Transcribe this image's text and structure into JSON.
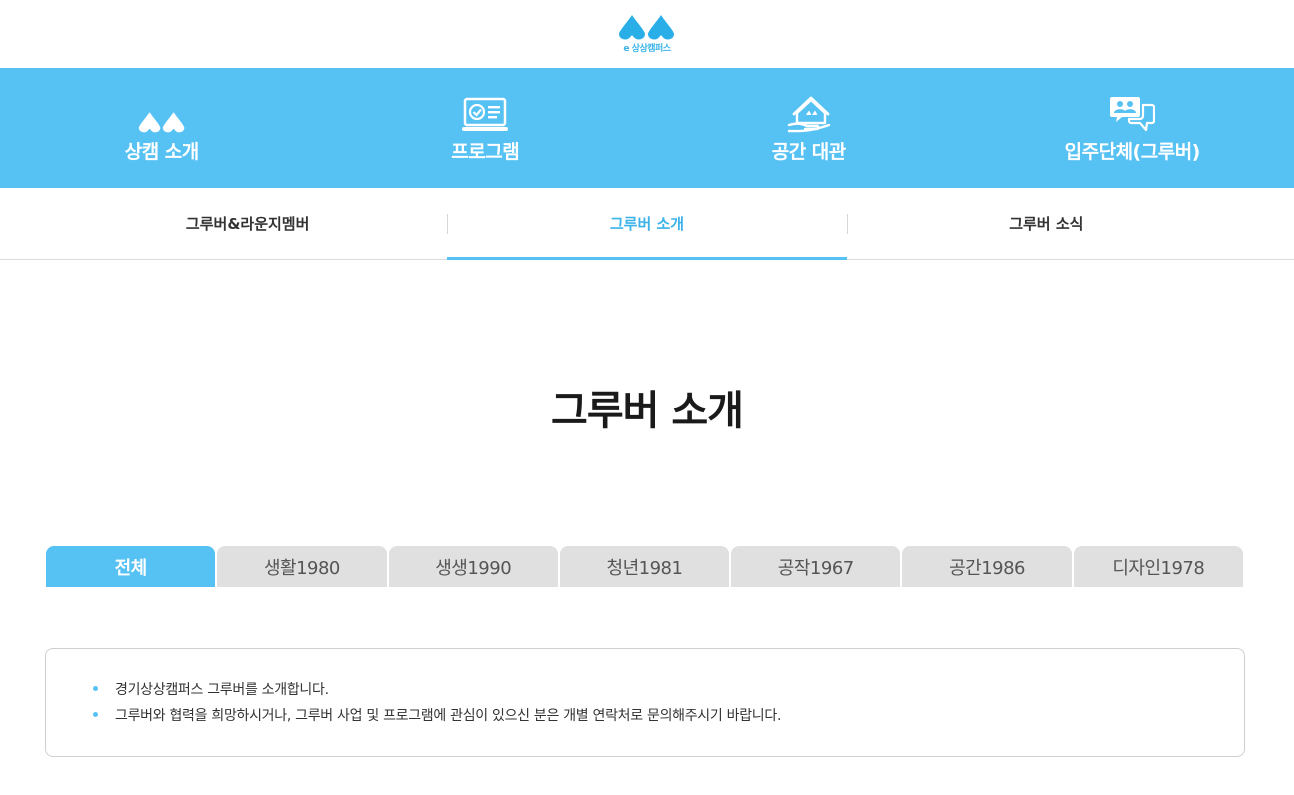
{
  "brand": {
    "logo_text": "e 상상캠퍼스",
    "primary_color": "#56c1f3",
    "accent_text_color": "#3bb3ea"
  },
  "main_nav": [
    {
      "label": "상캠 소개",
      "icon": "logo-drops-icon"
    },
    {
      "label": "프로그램",
      "icon": "laptop-check-icon"
    },
    {
      "label": "공간 대관",
      "icon": "house-hand-icon"
    },
    {
      "label": "입주단체(그루버)",
      "icon": "people-chat-icon"
    }
  ],
  "sub_nav": [
    {
      "label": "그루버&라운지멤버",
      "active": false
    },
    {
      "label": "그루버 소개",
      "active": true
    },
    {
      "label": "그루버 소식",
      "active": false
    }
  ],
  "page_title": "그루버 소개",
  "tabs": [
    {
      "label": "전체",
      "active": true
    },
    {
      "label": "생활1980",
      "active": false
    },
    {
      "label": "생생1990",
      "active": false
    },
    {
      "label": "청년1981",
      "active": false
    },
    {
      "label": "공작1967",
      "active": false
    },
    {
      "label": "공간1986",
      "active": false
    },
    {
      "label": "디자인1978",
      "active": false
    }
  ],
  "info": [
    "경기상상캠퍼스 그루버를 소개합니다.",
    "그루버와 협력을 희망하시거나, 그루버 사업 및 프로그램에 관심이 있으신 분은 개별 연락처로 문의해주시기 바랍니다."
  ]
}
